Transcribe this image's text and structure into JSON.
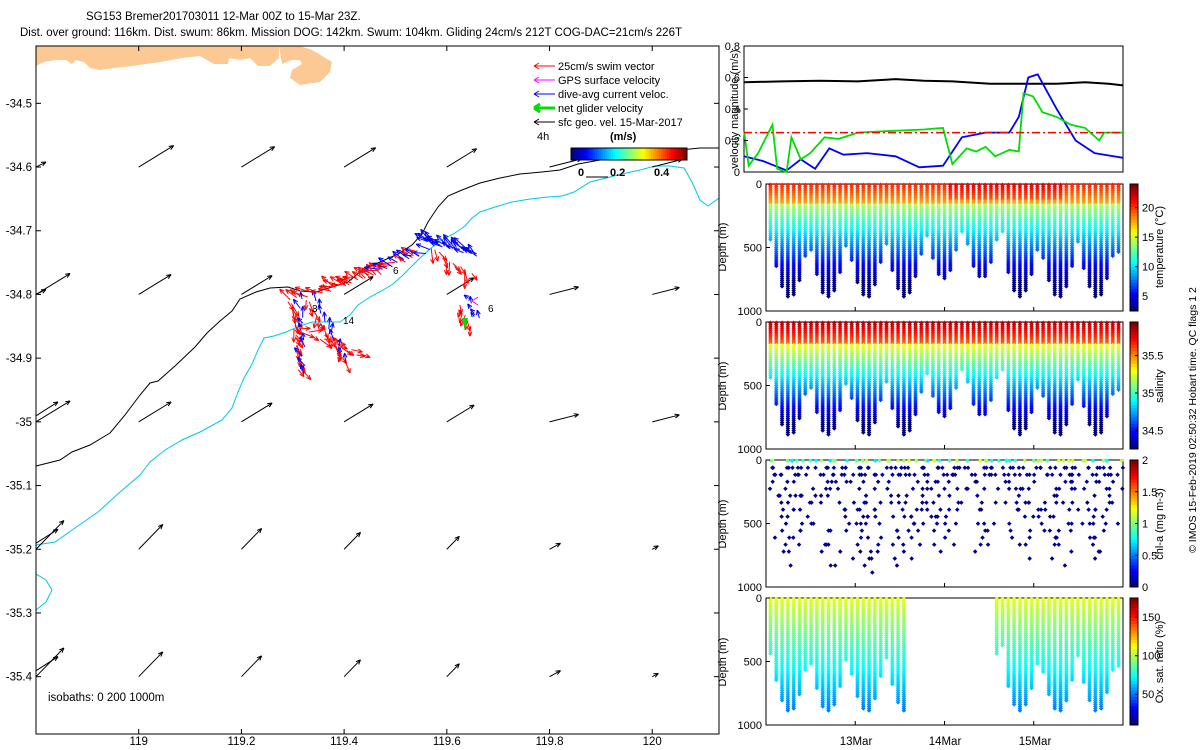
{
  "title": {
    "line1": "SG153 Bremer201703011 12-Mar 00Z to 15-Mar 23Z.",
    "line2": "Dist. over ground: 116km. Dist. swum: 86km. Mission DOG: 142km. Swum: 104km. Gliding 24cm/s 212T COG-DAC=21cm/s 226T"
  },
  "side_note": "© IMOS 15-Feb-2019 02:50:32 Hobart time. QC flags 1  2",
  "colors": {
    "land": "#fcc894",
    "coast": "#000000",
    "iso200": "#00c8e6",
    "swim": "#ff0000",
    "gps": "#ff00ff",
    "dac": "#0000ff",
    "net": "#00dd00",
    "geo": "#000000",
    "speed_ref": "#000000"
  },
  "chart_data": [
    {
      "id": "map",
      "type": "scatter",
      "title": "",
      "xlabel": "",
      "ylabel": "",
      "xlim": [
        118.8,
        120.13
      ],
      "ylim": [
        -35.49,
        -34.41
      ],
      "xticks": [
        "119",
        "119.2",
        "119.4",
        "119.6",
        "119.8",
        "120"
      ],
      "yticks": [
        "-34.5",
        "-34.6",
        "-34.7",
        "-34.8",
        "-34.9",
        "-35",
        "-35.1",
        "-35.2",
        "-35.3",
        "-35.4"
      ],
      "legend": {
        "placement": "top-right",
        "entries": [
          "25cm/s swim vector",
          "GPS surface velocity",
          "dive-avg current veloc.",
          "net glider velocity",
          "sfc geo. vel. 15-Mar-2017"
        ]
      },
      "colorbar": {
        "tick_labels": [
          "0",
          "0.2",
          "0.4"
        ],
        "label": "(m/s)",
        "interval_label": "4h",
        "range": [
          0,
          0.5
        ]
      },
      "isobath_label": "isobaths: 0   200  1000m",
      "waypoint_labels": [
        {
          "text": "3",
          "lon": 119.31,
          "lat": -34.84
        },
        {
          "text": "14",
          "lon": 119.38,
          "lat": -34.86
        },
        {
          "text": "6",
          "lon": 119.49,
          "lat": -34.786
        },
        {
          "text": "6",
          "lon": 119.67,
          "lat": -34.84
        }
      ],
      "geo_vectors_grid": {
        "lons": [
          118.8,
          119.0,
          119.2,
          119.4,
          119.6,
          119.8,
          120.0
        ],
        "lats": [
          -34.6,
          -34.8,
          -35.0,
          -35.2,
          -35.4
        ]
      }
    },
    {
      "id": "velocity",
      "type": "line",
      "xlabel": "",
      "ylabel": "velocity magnitude (m/s)",
      "xlim": [
        12.0,
        16.0
      ],
      "ylim": [
        0,
        0.8
      ],
      "yticks": [
        "0",
        "0.2",
        "0.4",
        "0.6",
        "0.8"
      ],
      "series": [
        {
          "name": "",
          "color": "#000000",
          "x": [
            12.0,
            12.4,
            12.8,
            13.2,
            13.6,
            13.9,
            14.2,
            14.6,
            15.0,
            15.3,
            15.6,
            15.85,
            16.0
          ],
          "y": [
            0.57,
            0.575,
            0.58,
            0.575,
            0.59,
            0.58,
            0.575,
            0.56,
            0.56,
            0.56,
            0.57,
            0.56,
            0.55
          ]
        },
        {
          "name": "",
          "color": "#0000ff",
          "x": [
            12.0,
            12.2,
            12.45,
            12.6,
            12.75,
            12.9,
            13.05,
            13.3,
            13.6,
            13.85,
            14.1,
            14.3,
            14.55,
            14.8,
            14.9,
            15.0,
            15.1,
            15.3,
            15.5,
            15.7,
            15.9,
            16.0
          ],
          "y": [
            0.1,
            0.07,
            0.01,
            0.08,
            0.02,
            0.15,
            0.11,
            0.12,
            0.1,
            0.03,
            0.04,
            0.22,
            0.25,
            0.25,
            0.35,
            0.6,
            0.62,
            0.4,
            0.2,
            0.12,
            0.1,
            0.09
          ]
        },
        {
          "name": "",
          "color": "#00dd00",
          "x": [
            12.0,
            12.05,
            12.15,
            12.3,
            12.35,
            12.45,
            12.5,
            12.6,
            12.7,
            12.85,
            13.0,
            13.2,
            13.5,
            13.9,
            14.1,
            14.2,
            14.35,
            14.45,
            14.55,
            14.65,
            14.8,
            14.9,
            14.95,
            15.05,
            15.15,
            15.3,
            15.45,
            15.6,
            15.75,
            15.8,
            16.0
          ],
          "y": [
            0.26,
            0.04,
            0.12,
            0.3,
            0.02,
            0.0,
            0.22,
            0.08,
            0.12,
            0.22,
            0.21,
            0.25,
            0.26,
            0.27,
            0.28,
            0.05,
            0.15,
            0.13,
            0.16,
            0.1,
            0.14,
            0.13,
            0.5,
            0.48,
            0.38,
            0.35,
            0.3,
            0.28,
            0.2,
            0.25,
            0.25
          ]
        },
        {
          "name": "",
          "color": "#ff0000",
          "x": [
            12.0,
            16.0
          ],
          "y": [
            0.25,
            0.25
          ]
        }
      ]
    },
    {
      "id": "temperature",
      "type": "scatter",
      "ylabel": "Depth (m)",
      "ylim": [
        1000,
        0
      ],
      "yticks": [
        "0",
        "500",
        "1000"
      ],
      "colorbar": {
        "label": "temperature (°C)",
        "range": [
          2.5,
          24
        ],
        "tick_labels": [
          "5",
          "10",
          "15",
          "20"
        ]
      }
    },
    {
      "id": "salinity",
      "type": "scatter",
      "ylabel": "Depth (m)",
      "ylim": [
        1000,
        0
      ],
      "yticks": [
        "0",
        "500",
        "1000"
      ],
      "colorbar": {
        "label": "salinity",
        "range": [
          34.25,
          35.95
        ],
        "tick_labels": [
          "34.5",
          "35",
          "35.5"
        ]
      }
    },
    {
      "id": "chla",
      "type": "scatter",
      "ylabel": "Depth (m)",
      "ylim": [
        1000,
        0
      ],
      "yticks": [
        "0",
        "500",
        "1000"
      ],
      "colorbar": {
        "label": "chl-a (mg m-3)",
        "range": [
          0,
          2
        ],
        "tick_labels": [
          "0",
          "0.5",
          "1",
          "1.5",
          "2"
        ]
      }
    },
    {
      "id": "oxygen",
      "type": "scatter",
      "ylabel": "Depth (m)",
      "ylim": [
        1000,
        0
      ],
      "yticks": [
        "0",
        "500",
        "1000"
      ],
      "xlim": [
        12.0,
        16.0
      ],
      "xticks": [
        "13Mar",
        "14Mar",
        "15Mar"
      ],
      "colorbar": {
        "label": "Ox. sat. ratio (%)",
        "range": [
          10,
          175
        ],
        "tick_labels": [
          "50",
          "100",
          "150"
        ]
      }
    }
  ]
}
